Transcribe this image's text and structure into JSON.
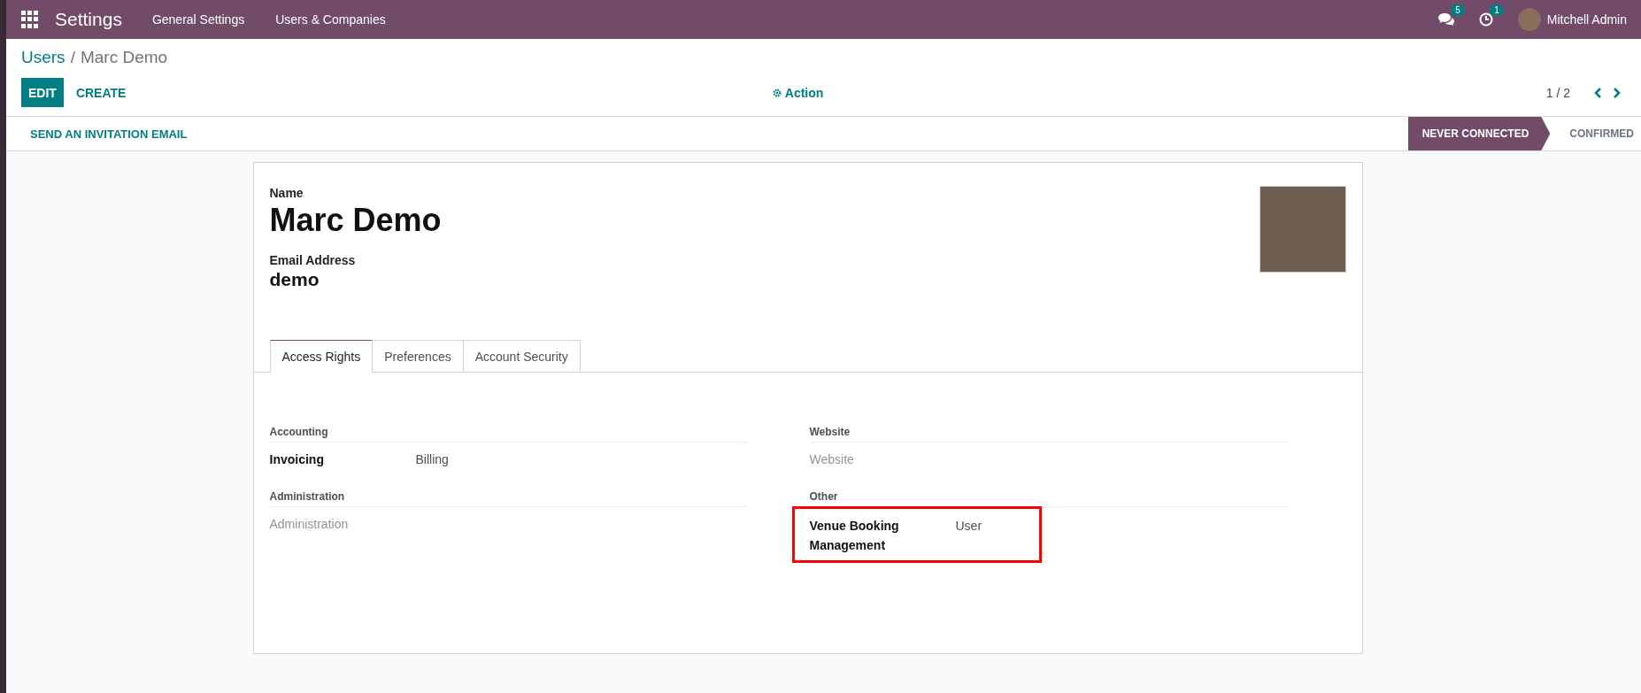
{
  "navbar": {
    "app_title": "Settings",
    "menus": [
      "General Settings",
      "Users & Companies"
    ],
    "messages_count": "5",
    "activities_count": "1",
    "user_name": "Mitchell Admin"
  },
  "breadcrumb": {
    "parent": "Users",
    "separator": "/",
    "current": "Marc Demo"
  },
  "control_panel": {
    "buttons": [
      {
        "label": "EDIT",
        "kind": "primary"
      },
      {
        "label": "CREATE",
        "kind": "link"
      }
    ],
    "action": "Action",
    "pager": "1 / 2"
  },
  "status_bar": {
    "button": "SEND AN INVITATION EMAIL",
    "steps": [
      {
        "label": "NEVER CONNECTED",
        "selected": true
      },
      {
        "label": "CONFIRMED",
        "selected": false
      }
    ]
  },
  "form": {
    "name_label": "Name",
    "name": "Marc Demo",
    "email_label": "Email Address",
    "email": "demo",
    "tabs": [
      {
        "label": "Access Rights",
        "selected": true
      },
      {
        "label": "Preferences",
        "selected": false
      },
      {
        "label": "Account Security",
        "selected": false
      }
    ],
    "groups": [
      {
        "title": "Accounting",
        "fields": [
          {
            "kind": "set",
            "label": "Invoicing",
            "value": "Billing",
            "highlighted": false
          }
        ]
      },
      {
        "title": "Website",
        "fields": [
          {
            "kind": "placeholder",
            "placeholder": "Website",
            "highlighted": false
          }
        ]
      },
      {
        "title": "Administration",
        "fields": [
          {
            "kind": "placeholder",
            "placeholder": "Administration",
            "highlighted": false
          }
        ]
      },
      {
        "title": "Other",
        "fields": [
          {
            "kind": "set",
            "label": "Venue Booking Management",
            "value": "User",
            "highlighted": true
          }
        ]
      }
    ]
  }
}
